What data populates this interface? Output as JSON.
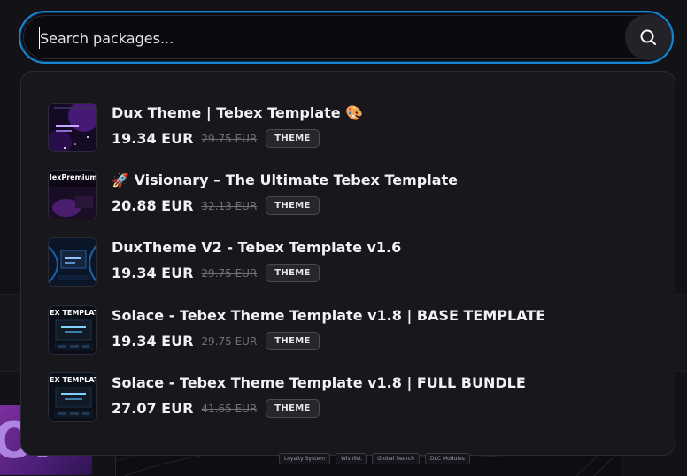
{
  "search": {
    "placeholder": "Search packages...",
    "value": "",
    "button_icon": "search-icon",
    "focus_color": "#1685d0"
  },
  "results": [
    {
      "title": "Dux Theme | Tebex Template",
      "emoji": "🎨",
      "price": "19.34 EUR",
      "old_price": "29.75 EUR",
      "badge": "THEME"
    },
    {
      "title": "Visionary – The Ultimate Tebex Template",
      "emoji": "🚀",
      "price": "20.88 EUR",
      "old_price": "32.13 EUR",
      "badge": "THEME",
      "thumb_text": "lexPremiumThem"
    },
    {
      "title": "DuxTheme V2 - Tebex Template v1.6",
      "price": "19.34 EUR",
      "old_price": "29.75 EUR",
      "badge": "THEME"
    },
    {
      "title": "Solace - Tebex Theme Template v1.8 | BASE TEMPLATE",
      "price": "19.34 EUR",
      "old_price": "29.75 EUR",
      "badge": "THEME",
      "thumb_text": "EX TEMPLATE SOL"
    },
    {
      "title": "Solace - Tebex Theme Template v1.8 | FULL BUNDLE",
      "price": "27.07 EUR",
      "old_price": "41.65 EUR",
      "badge": "THEME",
      "thumb_text": "EX TEMPLATE SOL"
    }
  ],
  "background": {
    "banner_text": "OI",
    "chips": [
      "Loyalty System",
      "Wishlist",
      "Global Search",
      "DLC Modules"
    ]
  },
  "colors": {
    "accent": "#1685d0",
    "panel": "#17171c",
    "badge_border": "#4a4a55",
    "muted_price": "#6f6f7a"
  }
}
